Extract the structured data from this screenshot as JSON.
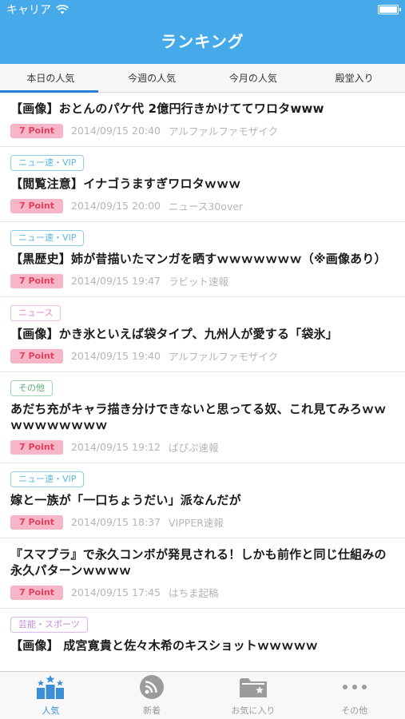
{
  "status": {
    "carrier": "キャリア"
  },
  "header": {
    "title": "ランキング"
  },
  "tabs": [
    {
      "label": "本日の人気",
      "active": true
    },
    {
      "label": "今週の人気"
    },
    {
      "label": "今月の人気"
    },
    {
      "label": "殿堂入り"
    }
  ],
  "items": [
    {
      "category": "",
      "title": "【画像】おとんのパケ代 2億円行きかけててワロタwww",
      "point": "7 Point",
      "date": "2014/09/15 20:40",
      "source": "アルファルファモザイク"
    },
    {
      "category": "ニュー速・VIP",
      "title": "【閲覧注意】イナゴうますぎワロタｗｗｗ",
      "point": "7 Point",
      "date": "2014/09/15 20:00",
      "source": "ニュース30over"
    },
    {
      "category": "ニュー速・VIP",
      "title": "【黒歴史】姉が昔描いたマンガを晒すｗｗｗｗｗｗｗ（※画像あり）",
      "point": "7 Point",
      "date": "2014/09/15 19:47",
      "source": "ラビット速報"
    },
    {
      "category": "ニュース",
      "title": "【画像】かき氷といえば袋タイプ、九州人が愛する「袋氷」",
      "point": "7 Point",
      "date": "2014/09/15 19:40",
      "source": "アルファルファモザイク"
    },
    {
      "category": "その他",
      "title": "あだち充がキャラ描き分けできないと思ってる奴、これ見てみろｗｗｗｗｗｗｗｗｗｗ",
      "point": "7 Point",
      "date": "2014/09/15 19:12",
      "source": "ぱぴぷ速報"
    },
    {
      "category": "ニュー速・VIP",
      "title": "嫁と一族が「一口ちょうだい」派なんだが",
      "point": "7 Point",
      "date": "2014/09/15 18:37",
      "source": "VIPPER速報"
    },
    {
      "category": "",
      "title": "『スマブラ』で永久コンボが発見される！しかも前作と同じ仕組みの永久パターンｗｗｗｗ",
      "point": "7 Point",
      "date": "2014/09/15 17:45",
      "source": "はちま起稿"
    },
    {
      "category": "芸能・スポーツ",
      "title": "【画像】 成宮寛貴と佐々木希のキスショットｗｗｗｗｗ",
      "point": "",
      "date": "",
      "source": ""
    }
  ],
  "tabbar": [
    {
      "label": "人気",
      "icon": "ranking-icon",
      "active": true
    },
    {
      "label": "新着",
      "icon": "rss-icon"
    },
    {
      "label": "お気に入り",
      "icon": "favorite-folder-icon"
    },
    {
      "label": "その他",
      "icon": "more-icon"
    }
  ],
  "colors": {
    "header": "#46a9ea",
    "accent": "#3a8fd6",
    "point_bg": "#f7b6c7",
    "point_text": "#e0405e"
  }
}
